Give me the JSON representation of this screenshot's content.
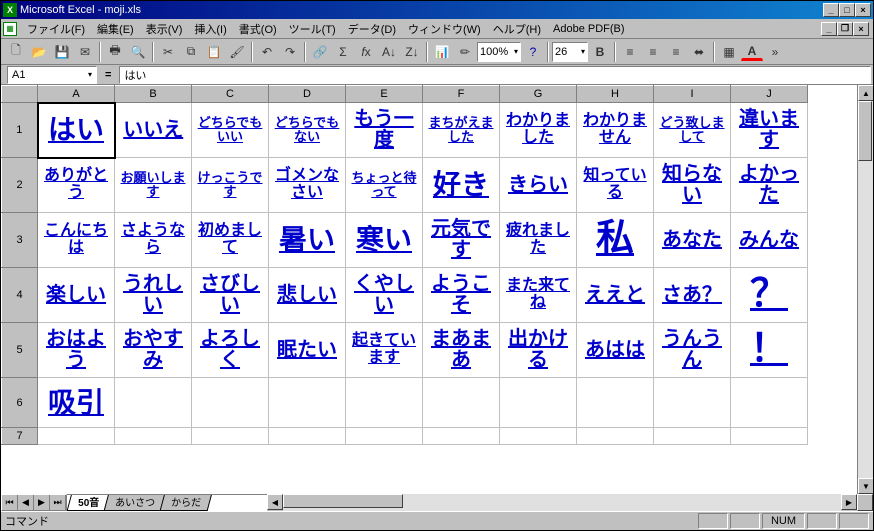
{
  "window": {
    "title": "Microsoft Excel - moji.xls"
  },
  "menu": {
    "file": "ファイル(F)",
    "edit": "編集(E)",
    "view": "表示(V)",
    "insert": "挿入(I)",
    "format": "書式(O)",
    "tools": "ツール(T)",
    "data": "データ(D)",
    "window": "ウィンドウ(W)",
    "help": "ヘルプ(H)",
    "adobe": "Adobe PDF(B)"
  },
  "toolbar": {
    "zoom": "100%",
    "fontsize": "26"
  },
  "namebox": "A1",
  "formula": "はい",
  "columns": [
    "A",
    "B",
    "C",
    "D",
    "E",
    "F",
    "G",
    "H",
    "I",
    "J"
  ],
  "rows": [
    "1",
    "2",
    "3",
    "4",
    "5",
    "6",
    "7"
  ],
  "cells": [
    [
      {
        "t": "はい",
        "s": "fs-big"
      },
      {
        "t": "いいえ",
        "s": "fs-med"
      },
      {
        "t": "どちらでもいい",
        "s": "fs-xs"
      },
      {
        "t": "どちらでもない",
        "s": "fs-xs"
      },
      {
        "t": "もう一度",
        "s": "fs-med"
      },
      {
        "t": "まちがえました",
        "s": "fs-xs"
      },
      {
        "t": "わかりました",
        "s": "fs-sm"
      },
      {
        "t": "わかりません",
        "s": "fs-sm"
      },
      {
        "t": "どう致しまして",
        "s": "fs-xs"
      },
      {
        "t": "違います",
        "s": "fs-med"
      }
    ],
    [
      {
        "t": "ありがとう",
        "s": "fs-sm"
      },
      {
        "t": "お願いします",
        "s": "fs-xs"
      },
      {
        "t": "けっこうです",
        "s": "fs-xs"
      },
      {
        "t": "ゴメンなさい",
        "s": "fs-sm"
      },
      {
        "t": "ちょっと待って",
        "s": "fs-xs"
      },
      {
        "t": "好き",
        "s": "fs-big"
      },
      {
        "t": "きらい",
        "s": "fs-med"
      },
      {
        "t": "知っている",
        "s": "fs-sm"
      },
      {
        "t": "知らない",
        "s": "fs-med"
      },
      {
        "t": "よかった",
        "s": "fs-med"
      }
    ],
    [
      {
        "t": "こんにちは",
        "s": "fs-sm"
      },
      {
        "t": "さようなら",
        "s": "fs-sm"
      },
      {
        "t": "初めまして",
        "s": "fs-sm"
      },
      {
        "t": "暑い",
        "s": "fs-big"
      },
      {
        "t": "寒い",
        "s": "fs-big"
      },
      {
        "t": "元気です",
        "s": "fs-med"
      },
      {
        "t": "疲れました",
        "s": "fs-sm"
      },
      {
        "t": "私",
        "s": "fs-huge"
      },
      {
        "t": "あなた",
        "s": "fs-med"
      },
      {
        "t": "みんな",
        "s": "fs-med"
      }
    ],
    [
      {
        "t": "楽しい",
        "s": "fs-med"
      },
      {
        "t": "うれしい",
        "s": "fs-med"
      },
      {
        "t": "さびしい",
        "s": "fs-med"
      },
      {
        "t": "悲しい",
        "s": "fs-med"
      },
      {
        "t": "くやしい",
        "s": "fs-med"
      },
      {
        "t": "ようこそ",
        "s": "fs-med"
      },
      {
        "t": "また来てね",
        "s": "fs-sm"
      },
      {
        "t": "ええと",
        "s": "fs-med"
      },
      {
        "t": "さあ？",
        "s": "fs-med"
      },
      {
        "t": "？",
        "s": "fs-huge"
      }
    ],
    [
      {
        "t": "おはよう",
        "s": "fs-med"
      },
      {
        "t": "おやすみ",
        "s": "fs-med"
      },
      {
        "t": "よろしく",
        "s": "fs-med"
      },
      {
        "t": "眠たい",
        "s": "fs-med"
      },
      {
        "t": "起きています",
        "s": "fs-sm"
      },
      {
        "t": "まあまあ",
        "s": "fs-med"
      },
      {
        "t": "出かける",
        "s": "fs-med"
      },
      {
        "t": "あはは",
        "s": "fs-med"
      },
      {
        "t": "うんうん",
        "s": "fs-med"
      },
      {
        "t": "！",
        "s": "fs-huge"
      }
    ],
    [
      {
        "t": "吸引",
        "s": "fs-big"
      },
      {
        "t": ""
      },
      {
        "t": ""
      },
      {
        "t": ""
      },
      {
        "t": ""
      },
      {
        "t": ""
      },
      {
        "t": ""
      },
      {
        "t": ""
      },
      {
        "t": ""
      },
      {
        "t": ""
      }
    ],
    [
      {
        "t": ""
      },
      {
        "t": ""
      },
      {
        "t": ""
      },
      {
        "t": ""
      },
      {
        "t": ""
      },
      {
        "t": ""
      },
      {
        "t": ""
      },
      {
        "t": ""
      },
      {
        "t": ""
      },
      {
        "t": ""
      }
    ]
  ],
  "sheets": {
    "active": "50音",
    "others": [
      "あいさつ",
      "からだ"
    ]
  },
  "status": {
    "mode": "コマンド",
    "num": "NUM"
  }
}
